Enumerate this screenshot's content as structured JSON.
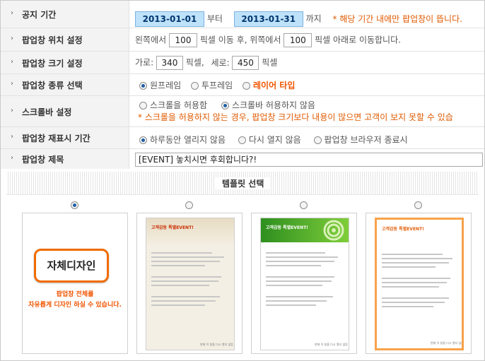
{
  "rows": {
    "period": {
      "label": "공지 기간",
      "start": "2013-01-01",
      "between": "부터",
      "end": "2013-01-31",
      "after": "까지",
      "note": "* 해당 기간 내에만 팝업창이 뜹니다."
    },
    "position": {
      "label": "팝업창 위치 설정",
      "prefix": "왼쪽에서",
      "left": "100",
      "mid": "픽셀 이동 후, 위쪽에서",
      "top": "100",
      "suffix": "픽셀 아래로 이동합니다."
    },
    "size": {
      "label": "팝업창 크기 설정",
      "w_label": "가로:",
      "width": "340",
      "w_unit": "픽셀,",
      "h_label": "세로:",
      "height": "450",
      "h_unit": "픽셀"
    },
    "type": {
      "label": "팝업창 종류 선택",
      "options": [
        "원프레임",
        "투프레임",
        "레이어 타입"
      ],
      "selected": "원프레임"
    },
    "scroll": {
      "label": "스크롤바 설정",
      "options": [
        "스크롤을 허용함",
        "스크롤바 허용하지 않음"
      ],
      "selected": "스크롤바 허용하지 않음",
      "note": "* 스크롤을 허용하지 않는 경우, 팝업창 크기보다 내용이 많으면 고객이 보지 못할 수 있습"
    },
    "redisplay": {
      "label": "팝업창 재표시 기간",
      "options": [
        "하루동안 열리지 않음",
        "다시 열지 않음",
        "팝업창 브라우저 종료시"
      ],
      "selected": "하루동안 열리지 않음"
    },
    "title": {
      "label": "팝업창 제목",
      "value": "[EVENT] 놓치시면 후회합니다?!"
    }
  },
  "templates": {
    "heading": "템플릿 선택",
    "self_design_label": "자체디자인",
    "self_design_desc_1": "팝업창 전체를",
    "self_design_desc_2": "자유롭게 디자인 하실 수 있습니다.",
    "card_title": "고객감동 특별EVENT!",
    "footer_text": "현재 이 창을 다시 열지 않음",
    "selected_index": 0
  },
  "colors": {
    "accent": "#f05400",
    "date_bg": "#bfe2fb",
    "radio_on": "#1f5fa6",
    "label_bg": "#f3f3f3"
  }
}
